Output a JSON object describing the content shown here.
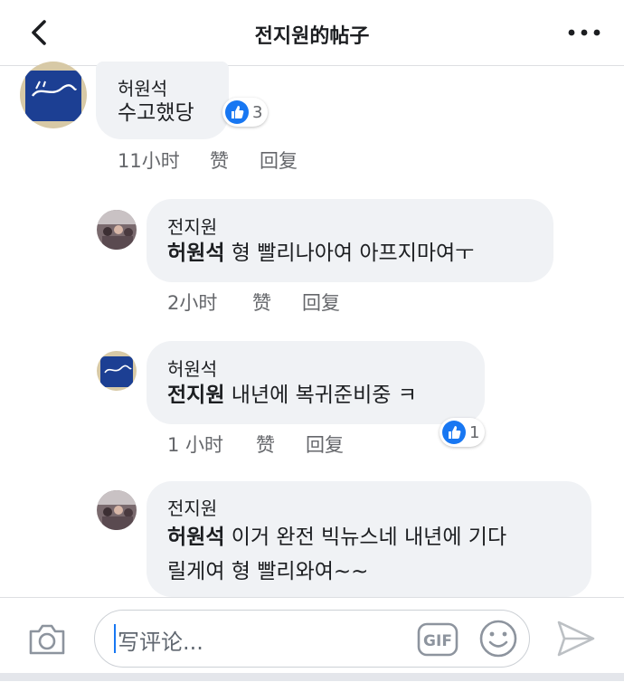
{
  "header": {
    "title": "전지원的帖子"
  },
  "comments": [
    {
      "author": "허원석",
      "text": "수고했당",
      "time": "11小时",
      "like_label": "赞",
      "reply_label": "回复",
      "reactions": "3"
    },
    {
      "author": "전지원",
      "mention": "허원석",
      "text": " 형 빨리나아여 아프지마여ㅜ",
      "time": "2小时",
      "like_label": "赞",
      "reply_label": "回复"
    },
    {
      "author": "허원석",
      "mention": "전지원",
      "text": " 내년에 복귀준비중 ㅋ",
      "time": "1 小时",
      "like_label": "赞",
      "reply_label": "回复",
      "reactions": "1"
    },
    {
      "author": "전지원",
      "mention": "허원석",
      "text_line1": " 이거 완전 빅뉴스네 내년에 기다",
      "text_line2": "릴게여 형 빨리와여~~"
    }
  ],
  "composer": {
    "placeholder": "写评论...",
    "gif_label": "GIF"
  },
  "colors": {
    "accent": "#1877f2",
    "bubble": "#f0f2f5",
    "meta": "#65676b"
  },
  "icons": [
    "back-arrow-icon",
    "more-icon",
    "like-icon",
    "camera-icon",
    "gif-icon",
    "emoji-icon",
    "send-icon"
  ]
}
